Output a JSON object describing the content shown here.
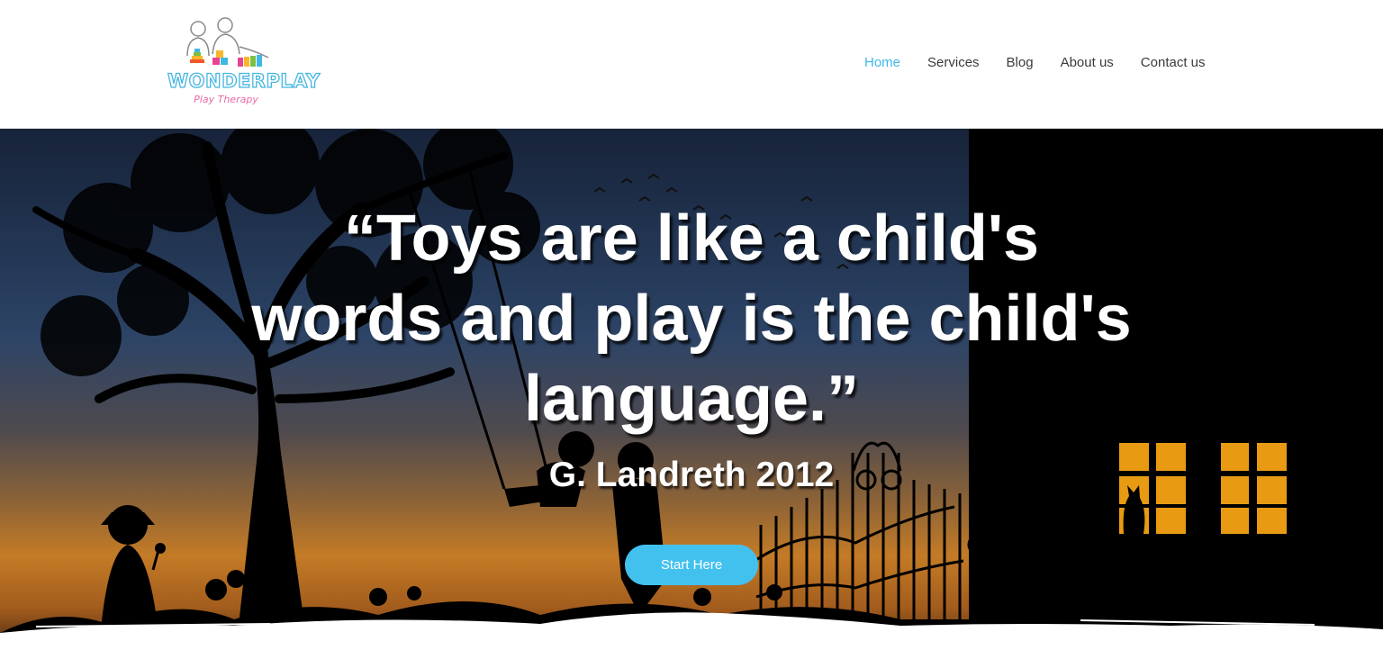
{
  "brand": {
    "name": "WONDERPLAY",
    "tagline": "Play Therapy",
    "colors": {
      "title_outline": "#46b6e0",
      "tagline": "#ea6aa6"
    }
  },
  "nav": {
    "items": [
      {
        "label": "Home",
        "active": true
      },
      {
        "label": "Services",
        "active": false
      },
      {
        "label": "Blog",
        "active": false
      },
      {
        "label": "About us",
        "active": false
      },
      {
        "label": "Contact us",
        "active": false
      }
    ],
    "colors": {
      "active": "#3fb8e6",
      "default": "#3a3a3a"
    }
  },
  "hero": {
    "quote": "“Toys are like a child's words and play is the child's language.”",
    "author": "G. Landreth 2012",
    "cta_label": "Start Here",
    "colors": {
      "cta": "#42c1ef",
      "text": "#ffffff"
    }
  },
  "icons": [
    "wonderplay-logo-icon"
  ]
}
